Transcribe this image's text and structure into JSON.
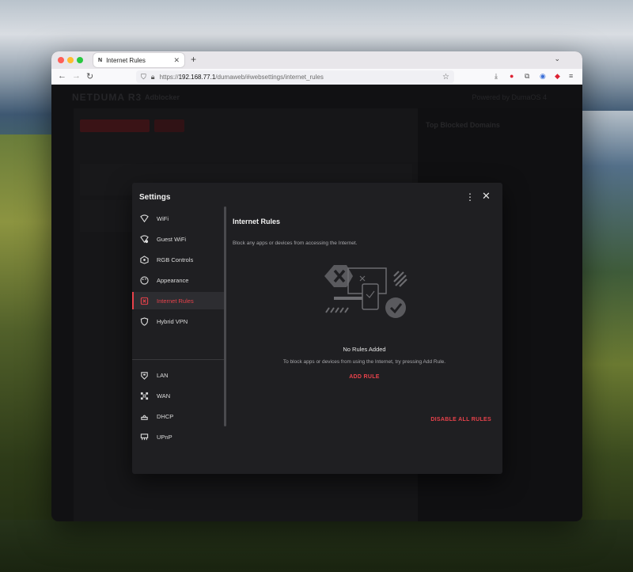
{
  "browser": {
    "tab_favicon": "N",
    "tab_title": "Internet Rules",
    "new_tab_symbol": "+",
    "url_prefix": "https://",
    "url_host": "192.168.77.1",
    "url_path": "/dumaweb/#websettings/internet_rules"
  },
  "background_app": {
    "brand": "NETDUMA R3",
    "section": "Adblocker",
    "powered_by": "Powered by DumaOS 4",
    "right_title": "Top Blocked Domains"
  },
  "modal": {
    "title": "Settings",
    "nav_items": [
      {
        "label": "WiFi",
        "icon": "wifi-icon"
      },
      {
        "label": "Guest WiFi",
        "icon": "guest-wifi-icon"
      },
      {
        "label": "RGB Controls",
        "icon": "rgb-icon"
      },
      {
        "label": "Appearance",
        "icon": "palette-icon"
      },
      {
        "label": "Internet Rules",
        "icon": "internet-rules-icon",
        "active": true
      },
      {
        "label": "Hybrid VPN",
        "icon": "shield-icon"
      },
      {
        "label": "LAN",
        "icon": "lan-icon"
      },
      {
        "label": "WAN",
        "icon": "wan-icon"
      },
      {
        "label": "DHCP",
        "icon": "dhcp-icon"
      },
      {
        "label": "UPnP",
        "icon": "upnp-icon"
      }
    ],
    "panel": {
      "title": "Internet Rules",
      "description": "Block any apps or devices from accessing the Internet.",
      "empty_title": "No Rules Added",
      "empty_subtitle": "To block apps or devices from using the Internet, try pressing Add Rule.",
      "add_rule": "ADD RULE",
      "disable_all": "DISABLE ALL RULES"
    }
  },
  "colors": {
    "accent": "#e8424b",
    "modal_bg": "#1f1f22",
    "text": "#dcdcdc"
  }
}
